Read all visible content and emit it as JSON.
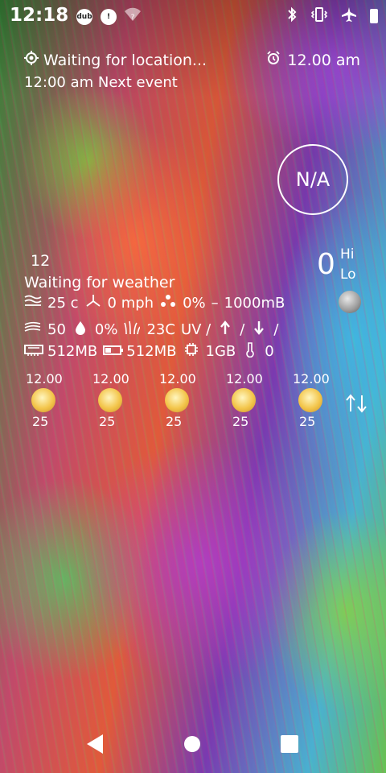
{
  "status_bar": {
    "time": "12:18",
    "left_icons": [
      {
        "name": "dub-icon",
        "text": "dub"
      },
      {
        "name": "sim-alert-icon",
        "text": "!"
      },
      {
        "name": "wifi-unknown-icon",
        "text": "?"
      }
    ],
    "right_icons": [
      "bluetooth-icon",
      "vibrate-icon",
      "airplane-icon",
      "battery-icon"
    ]
  },
  "widget": {
    "location_text": "Waiting for location...",
    "alarm_time": "12.00 am",
    "next_event": "12:00 am Next event",
    "aqi_circle": "N/A",
    "current_temp_small": "12",
    "weather_status": "Waiting for weather",
    "big_temp": "0",
    "hi_label": "Hi",
    "lo_label": "Lo",
    "row1": {
      "feels": "25 c",
      "wind": "0 mph",
      "precip": "0%",
      "pressure_sep": "–",
      "pressure": "1000mB"
    },
    "row2": {
      "air": "50",
      "humidity": "0%",
      "dew": "23C",
      "uv": "UV /",
      "sunrise": "/",
      "sunset": "/"
    },
    "row3": {
      "ram": "512MB",
      "battery": "512MB",
      "cpu": "1GB",
      "temp": "0"
    }
  },
  "forecast": [
    {
      "time": "12.00",
      "temp": "25"
    },
    {
      "time": "12.00",
      "temp": "25"
    },
    {
      "time": "12.00",
      "temp": "25"
    },
    {
      "time": "12.00",
      "temp": "25"
    },
    {
      "time": "12.00",
      "temp": "25"
    }
  ],
  "colors": {
    "text": "#ffffff",
    "sun": "#f3c54a"
  }
}
